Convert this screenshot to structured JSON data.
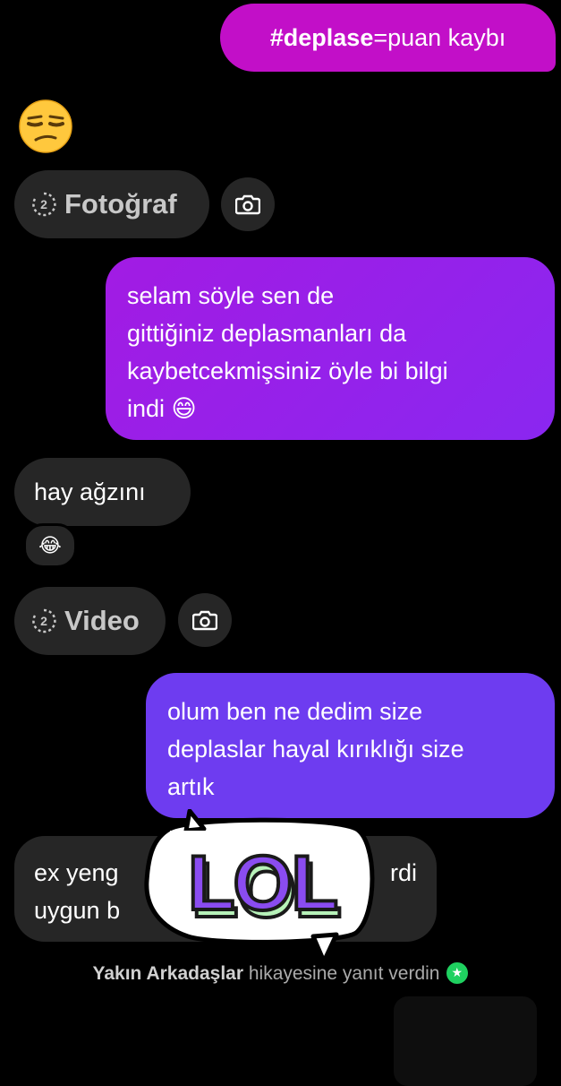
{
  "messages": {
    "m1": {
      "hashtag": "#deplase",
      "rest": "=puan kaybı"
    },
    "m2_emoji": "😒",
    "photo_label": "Fotoğraf",
    "m3": [
      "selam söyle sen de",
      "gittiğiniz deplasmanları da",
      "kaybetcekmişsiniz öyle bi bilgi",
      "indi 😄"
    ],
    "m4": "hay ağzını",
    "m4_reaction": "😂",
    "video_label": "Video",
    "m5": [
      "olum ben ne dedim size",
      "deplaslar hayal kırıklığı size",
      "artık"
    ],
    "m6": [
      "ex yeng",
      "rdi",
      "uygun b"
    ],
    "sticker_text": "LOL"
  },
  "footer": {
    "bold": "Yakın Arkadaşlar",
    "rest": " hikayesine yanıt verdin"
  },
  "colors": {
    "bubble_magenta": "#c20fc8",
    "bubble_purple": "#9b22ea",
    "bubble_violet": "#6e3cf0",
    "bubble_incoming": "#262626",
    "close_friends_green": "#1fd160"
  }
}
